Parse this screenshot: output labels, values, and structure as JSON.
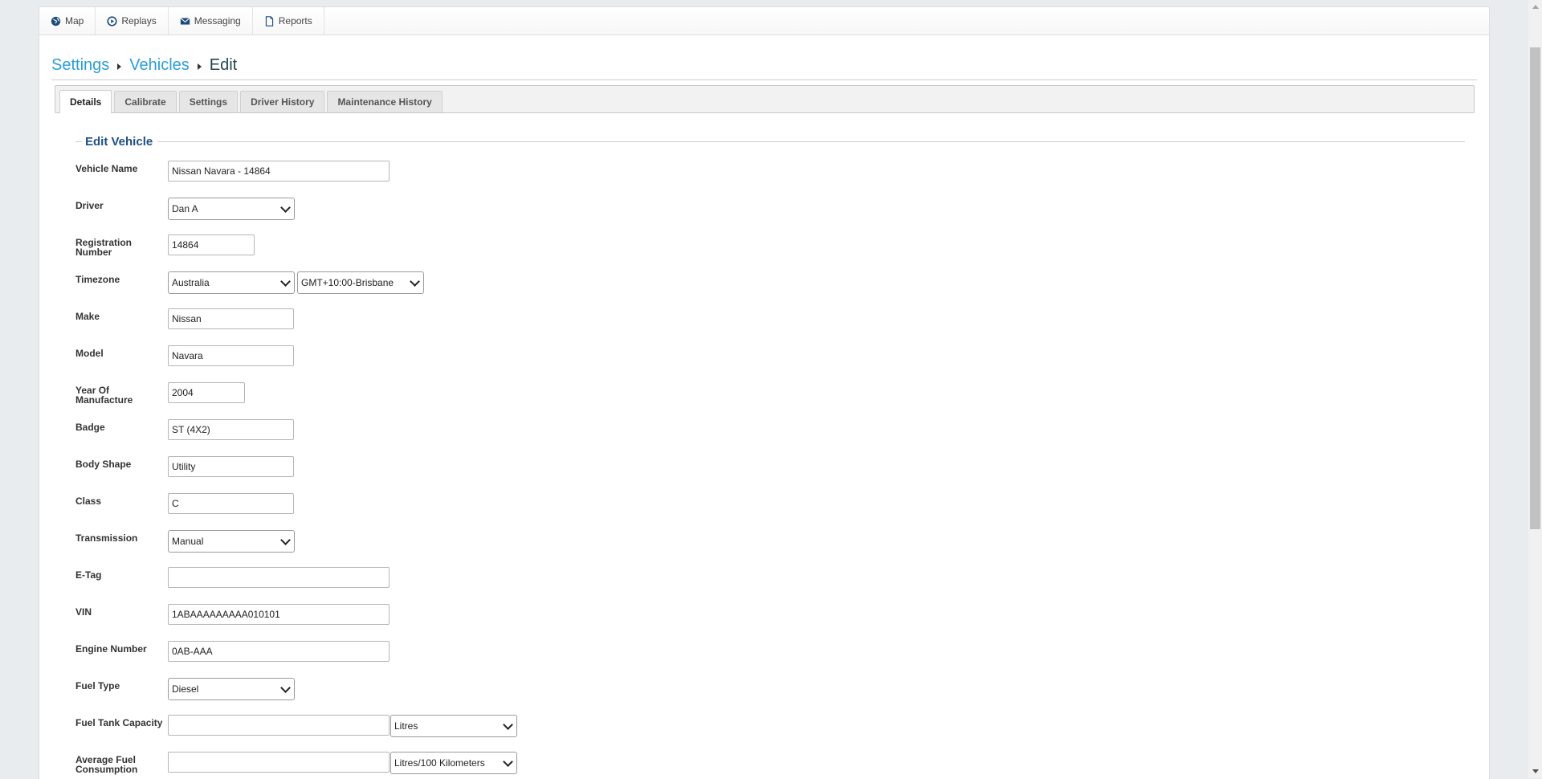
{
  "nav": {
    "items": [
      {
        "label": "Map",
        "icon": "globe-icon"
      },
      {
        "label": "Replays",
        "icon": "play-circle-icon"
      },
      {
        "label": "Messaging",
        "icon": "envelope-icon"
      },
      {
        "label": "Reports",
        "icon": "file-icon"
      }
    ]
  },
  "breadcrumb": {
    "settings": "Settings",
    "vehicles": "Vehicles",
    "current": "Edit"
  },
  "tabs": [
    "Details",
    "Calibrate",
    "Settings",
    "Driver History",
    "Maintenance History"
  ],
  "form": {
    "title": "Edit Vehicle",
    "vehicle_name": {
      "label": "Vehicle Name",
      "value": "Nissan Navara - 14864"
    },
    "driver": {
      "label": "Driver",
      "value": "Dan A"
    },
    "registration": {
      "label": "Registration Number",
      "value": "14864"
    },
    "timezone": {
      "label": "Timezone",
      "region": "Australia",
      "zone": "GMT+10:00-Brisbane"
    },
    "make": {
      "label": "Make",
      "value": "Nissan"
    },
    "model": {
      "label": "Model",
      "value": "Navara"
    },
    "year": {
      "label": "Year Of Manufacture",
      "value": "2004"
    },
    "badge": {
      "label": "Badge",
      "value": "ST (4X2)"
    },
    "body_shape": {
      "label": "Body Shape",
      "value": "Utility"
    },
    "class": {
      "label": "Class",
      "value": "C"
    },
    "transmission": {
      "label": "Transmission",
      "value": "Manual"
    },
    "etag": {
      "label": "E-Tag",
      "value": ""
    },
    "vin": {
      "label": "VIN",
      "value": "1ABAAAAAAAAA010101"
    },
    "engine_number": {
      "label": "Engine Number",
      "value": "0AB-AAA"
    },
    "fuel_type": {
      "label": "Fuel Type",
      "value": "Diesel"
    },
    "fuel_tank": {
      "label": "Fuel Tank Capacity",
      "value": "",
      "unit": "Litres"
    },
    "avg_fuel": {
      "label": "Average Fuel Consumption",
      "value": "",
      "unit": "Litres/100 Kilometers"
    }
  }
}
